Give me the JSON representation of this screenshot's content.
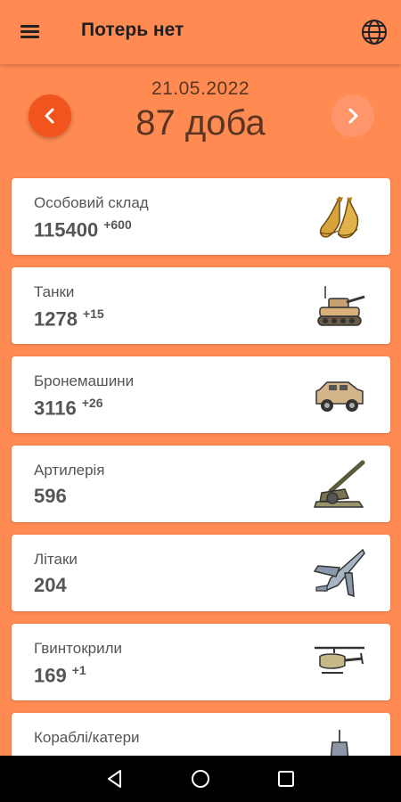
{
  "app": {
    "title": "Потерь нет"
  },
  "header": {
    "date": "21.05.2022",
    "day_label": "87 доба"
  },
  "stats": [
    {
      "label": "Особовий склад",
      "value": "115400",
      "delta": "+600",
      "icon": "boots-icon"
    },
    {
      "label": "Танки",
      "value": "1278",
      "delta": "+15",
      "icon": "tank-icon"
    },
    {
      "label": "Бронемашини",
      "value": "3116",
      "delta": "+26",
      "icon": "armored-vehicle-icon"
    },
    {
      "label": "Артилерія",
      "value": "596",
      "delta": "",
      "icon": "artillery-icon"
    },
    {
      "label": "Літаки",
      "value": "204",
      "delta": "",
      "icon": "jet-icon"
    },
    {
      "label": "Гвинтокрили",
      "value": "169",
      "delta": "+1",
      "icon": "helicopter-icon"
    },
    {
      "label": "Кораблі/катери",
      "value": "",
      "delta": "",
      "icon": "ship-icon"
    }
  ],
  "colors": {
    "background": "#ff8a52",
    "accent": "#f2541d",
    "card": "#ffffff"
  }
}
